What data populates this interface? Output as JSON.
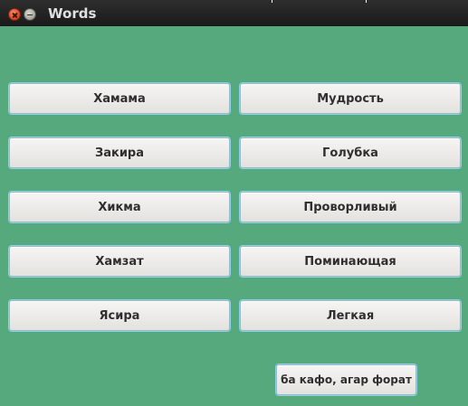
{
  "window": {
    "title": "Words",
    "close_icon": "close-icon",
    "minimize_icon": "minimize-icon"
  },
  "words": {
    "left": [
      "Хамама",
      "Закира",
      "Хикма",
      "Хамзат",
      "Ясира"
    ],
    "right": [
      "Мудрость",
      "Голубка",
      "Проворливый",
      "Поминающая",
      "Легкая"
    ]
  },
  "footer": {
    "action_label": "ба кафо, агар форат"
  },
  "colors": {
    "background": "#56a97d",
    "titlebar": "#1a1a1a",
    "button_face": "#eceae8",
    "button_glow": "#86d5e8"
  }
}
